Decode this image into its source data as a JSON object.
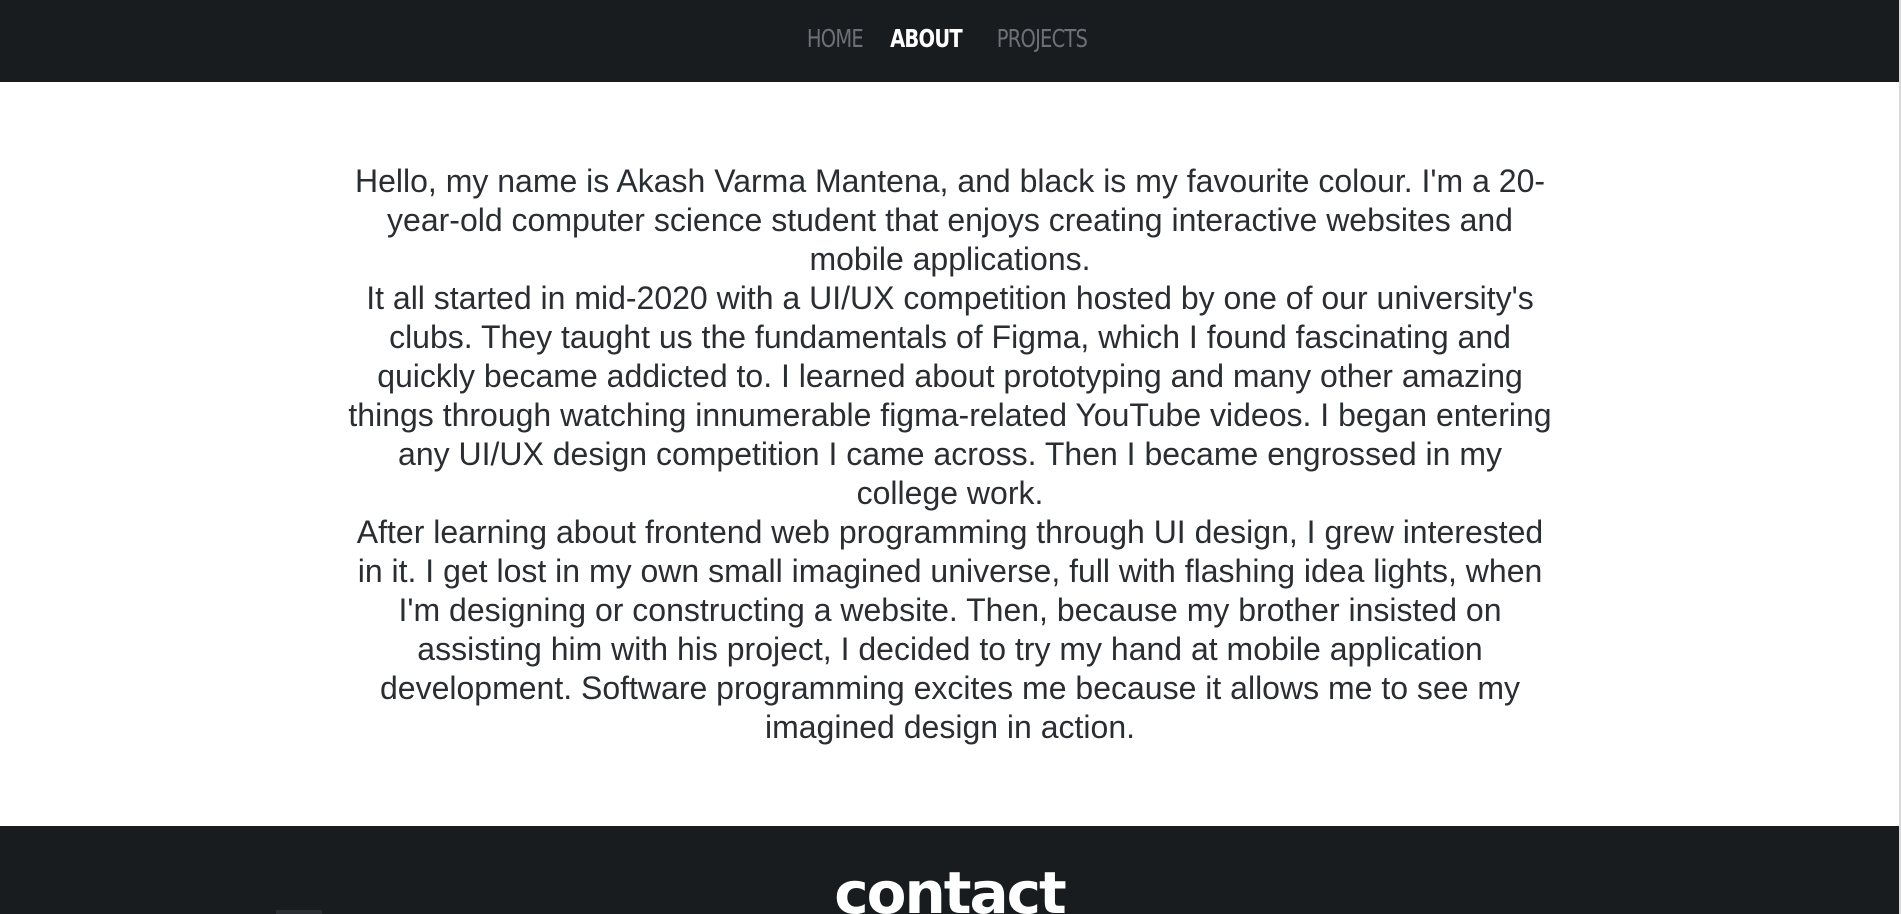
{
  "navbar": {
    "links": [
      {
        "label": "HOME",
        "active": false
      },
      {
        "label": "ABOUT",
        "active": true
      },
      {
        "label": "PROJECTS",
        "active": false
      }
    ]
  },
  "about": {
    "paragraphs": [
      "Hello, my name is Akash Varma Mantena, and black is my favourite colour. I'm a 20-year-old computer science student that enjoys creating interactive websites and mobile applications.",
      "It all started in mid-2020 with a UI/UX competition hosted by one of our university's clubs. They taught us the fundamentals of Figma, which I found fascinating and quickly became addicted to. I learned about prototyping and many other amazing things through watching innumerable figma-related YouTube videos. I began entering any UI/UX design competition I came across. Then I became engrossed in my college work.",
      "After learning about frontend web programming through UI design, I grew interested in it. I get lost in my own small imagined universe, full with flashing idea lights, when I'm designing or constructing a website. Then, because my brother insisted on assisting him with his project, I decided to try my hand at mobile application development. Software programming excites me because it allows me to see my imagined design in action."
    ]
  },
  "footer": {
    "title": "contact"
  },
  "colors": {
    "nav_background": "#191c1f",
    "nav_inactive": "#6c7177",
    "nav_active": "#ffffff",
    "body_text": "#2a2d31",
    "page_background": "#ffffff"
  }
}
